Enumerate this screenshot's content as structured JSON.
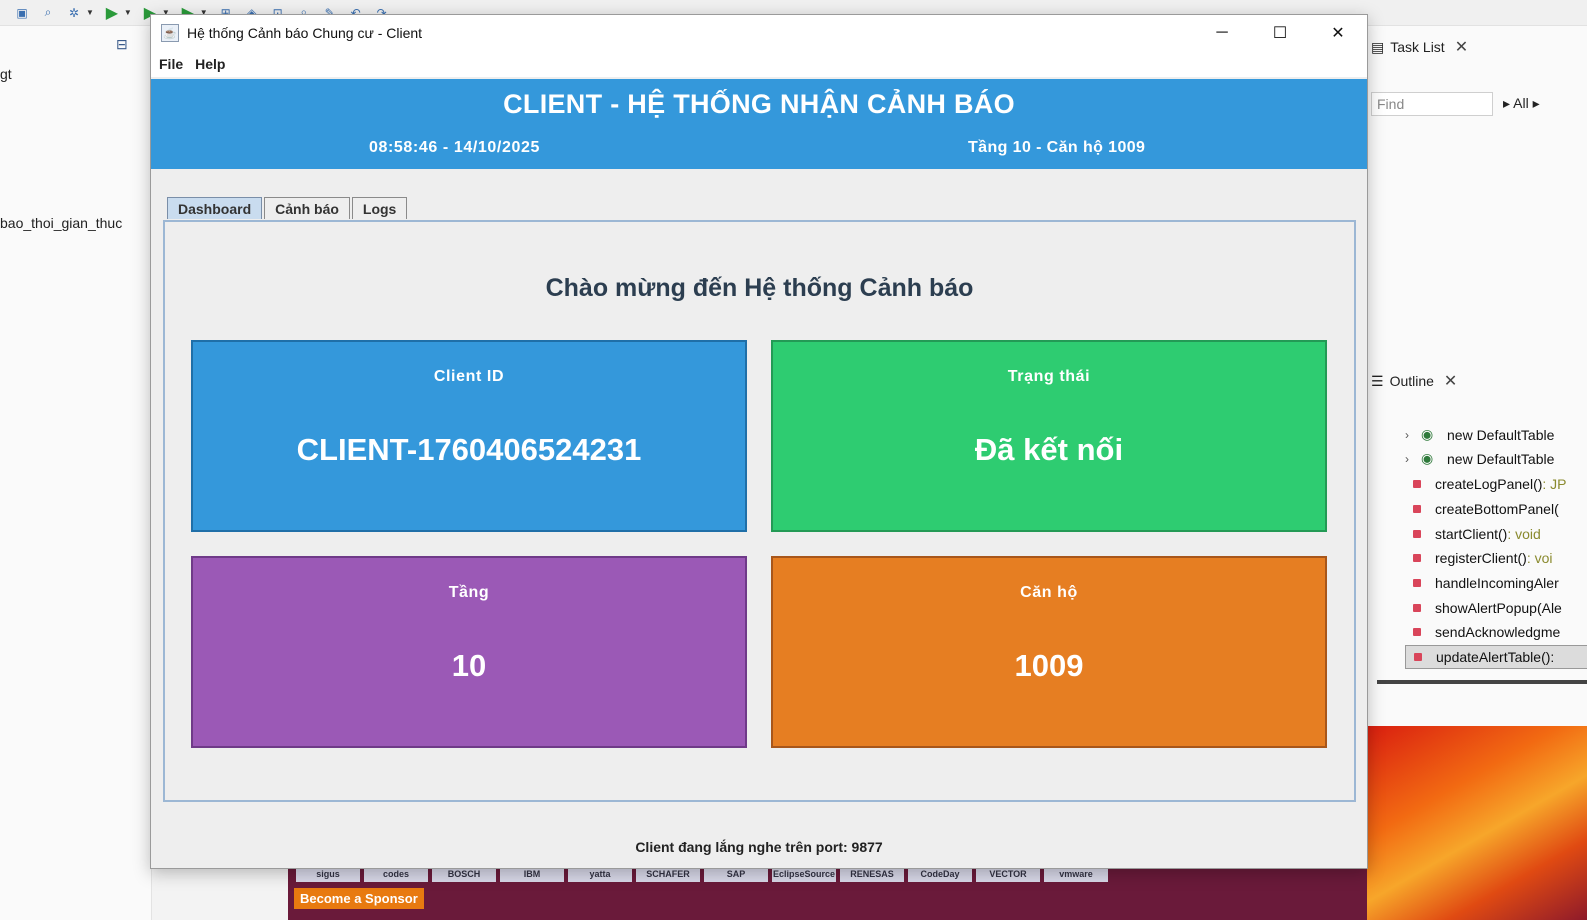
{
  "background": {
    "left_tree": [
      "gt",
      "bao_thoi_gian_thuc"
    ],
    "task_list": {
      "label": "Task List",
      "find_placeholder": "Find",
      "filter": "All"
    },
    "outline": {
      "label": "Outline",
      "items": [
        {
          "text": "new DefaultTable",
          "type": ""
        },
        {
          "text": "new DefaultTable",
          "type": ""
        },
        {
          "text": "createLogPanel()",
          "type": " : JP"
        },
        {
          "text": "createBottomPanel(",
          "type": ""
        },
        {
          "text": "startClient()",
          "type": " : void"
        },
        {
          "text": "registerClient()",
          "type": " : voi"
        },
        {
          "text": "handleIncomingAler",
          "type": ""
        },
        {
          "text": "showAlertPopup(Ale",
          "type": ""
        },
        {
          "text": "sendAcknowledgme",
          "type": ""
        },
        {
          "text": "updateAlertTable()",
          "type": " :"
        }
      ]
    },
    "sponsor": {
      "logos": [
        "sigus",
        "codes",
        "BOSCH",
        "IBM",
        "yatta",
        "SCHAFER",
        "SAP",
        "EclipseSource",
        "RENESAS",
        "CodeDay",
        "VECTOR",
        "vmware"
      ],
      "button": "Become a Sponsor"
    }
  },
  "window": {
    "title": "Hệ thống Cảnh báo Chung cư - Client",
    "controls": {
      "minimize": "─",
      "maximize": "☐",
      "close": "✕"
    },
    "menu": [
      "File",
      "Help"
    ],
    "header": {
      "title": "CLIENT - HỆ THỐNG NHẬN CẢNH BÁO",
      "datetime": "08:58:46 - 14/10/2025",
      "location": "Tầng 10 - Căn hộ 1009"
    },
    "tabs": [
      "Dashboard",
      "Cảnh báo",
      "Logs"
    ],
    "active_tab": "Dashboard",
    "dashboard": {
      "welcome": "Chào mừng đến Hệ thống Cảnh báo",
      "cards": [
        {
          "label": "Client ID",
          "value": "CLIENT-1760406524231",
          "color": "#3498db",
          "border": "#1f6fa8"
        },
        {
          "label": "Trạng thái",
          "value": "Đã kết nối",
          "color": "#2ecc71",
          "border": "#239a55"
        },
        {
          "label": "Tầng",
          "value": "10",
          "color": "#9b59b6",
          "border": "#6f3a88"
        },
        {
          "label": "Căn hộ",
          "value": "1009",
          "color": "#e67e22",
          "border": "#a8561a"
        }
      ]
    },
    "status_bar": "Client đang lắng nghe trên port: 9877"
  }
}
